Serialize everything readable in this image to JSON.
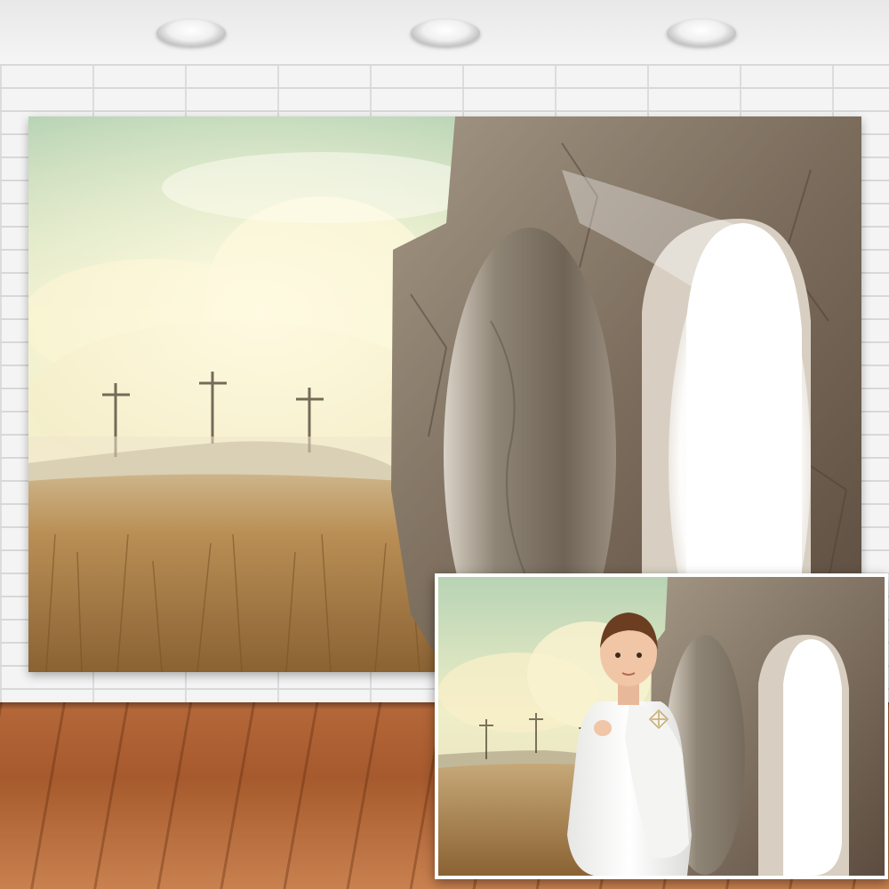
{
  "scene": {
    "description_free": true,
    "backdrop_colors": {
      "sky_top": "#bcd6b8",
      "sky_glow": "#fbf6d2",
      "grass": "#b48a4c",
      "rock": "#8c7d6d",
      "tomb_light": "#ffffff"
    },
    "floor_color": "#b5683a",
    "wall_color": "#f4f4f4",
    "crosses_count": 3,
    "icons": [
      "ceiling-lamp-icon",
      "cross-icon",
      "tomb-stone-icon"
    ]
  }
}
